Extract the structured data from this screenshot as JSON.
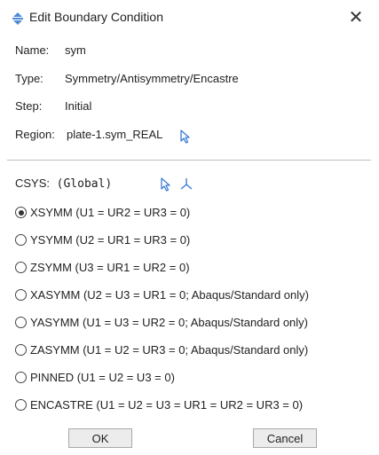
{
  "dialog": {
    "title": "Edit Boundary Condition",
    "close_glyph": "✕",
    "title_icon": "boundary-condition-icon"
  },
  "info": {
    "name_label": "Name:",
    "name_value": "sym",
    "type_label": "Type:",
    "type_value": "Symmetry/Antisymmetry/Encastre",
    "step_label": "Step:",
    "step_value": "Initial",
    "region_label": "Region:",
    "region_value": "plate-1.sym_REAL"
  },
  "csys": {
    "label": "CSYS:",
    "value": "(Global)"
  },
  "options": [
    {
      "label": "XSYMM (U1 = UR2 = UR3 = 0)",
      "checked": true
    },
    {
      "label": "YSYMM (U2 = UR1 = UR3 = 0)",
      "checked": false
    },
    {
      "label": "ZSYMM (U3 = UR1 = UR2 = 0)",
      "checked": false
    },
    {
      "label": "XASYMM (U2 = U3 = UR1 = 0; Abaqus/Standard only)",
      "checked": false
    },
    {
      "label": "YASYMM (U1 = U3 = UR2 = 0; Abaqus/Standard only)",
      "checked": false
    },
    {
      "label": "ZASYMM (U1 = U2 = UR3 = 0; Abaqus/Standard only)",
      "checked": false
    },
    {
      "label": "PINNED (U1 = U2 = U3 = 0)",
      "checked": false
    },
    {
      "label": "ENCASTRE (U1 = U2 = U3 = UR1 = UR2 = UR3 = 0)",
      "checked": false
    }
  ],
  "buttons": {
    "ok": "OK",
    "cancel": "Cancel"
  },
  "colors": {
    "accent_icon": "#3b7bd9",
    "background": "#ffffff"
  }
}
